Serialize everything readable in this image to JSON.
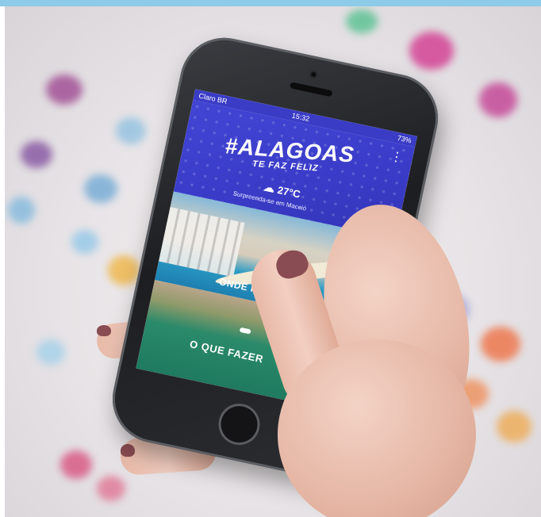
{
  "app": {
    "status": {
      "carrier": "Claro BR",
      "time": "15:32",
      "battery": "73%"
    },
    "menu_glyph": "⋮",
    "logo": {
      "main": "#ALAGOAS",
      "sub": "TE FAZ FELIZ"
    },
    "weather": {
      "icon": "cloud-sun-icon",
      "temperature": "27°C",
      "caption": "Surpreenda-se em Maceió"
    },
    "sections": [
      {
        "label": "ONDE FICAR"
      },
      {
        "label": "O QUE FAZER"
      }
    ]
  },
  "colors": {
    "hero": "#3a3cc8",
    "topbar": "#8ecbe8"
  }
}
